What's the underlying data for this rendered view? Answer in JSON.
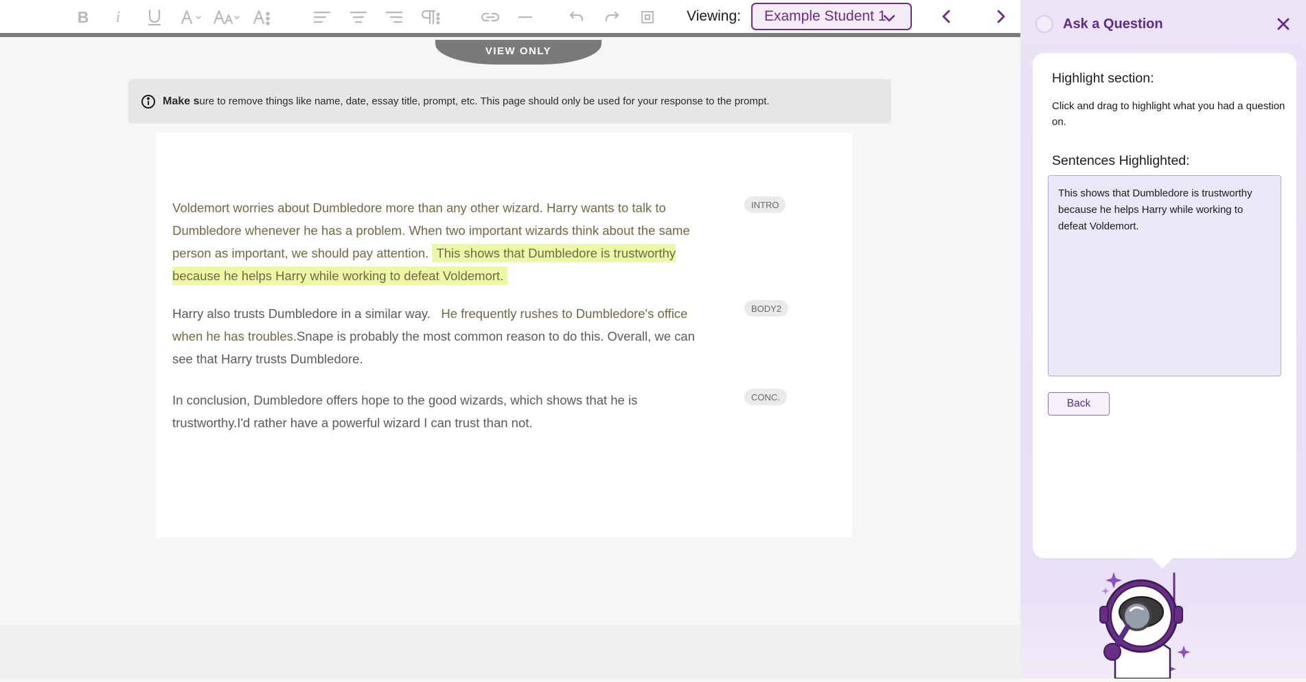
{
  "toolbar": {
    "viewing_label": "Viewing:",
    "student_selected": "Example Student 1",
    "tools": [
      "bold",
      "italic",
      "underline",
      "font-color",
      "font-size",
      "text-style",
      "align-left",
      "align-center",
      "align-right",
      "paragraph",
      "link",
      "horizontal-rule",
      "undo",
      "redo",
      "select-all"
    ]
  },
  "editor": {
    "view_only_label": "VIEW ONLY",
    "notice": {
      "bold_text": "Make s",
      "text": "ure to remove things like name, date, essay title, prompt, etc. This page should only be used for your response to the prompt."
    },
    "paragraphs": [
      {
        "tag": "INTRO",
        "lines": [
          "Voldemort worries about Dumbledore more than any other wizard.  Harry wants to talk to Dumbledore whenever he has a problem.  When two important wizards think about the same person as important, we should pay attention. "
        ],
        "highlighted": "This shows that Dumbledore is trustworthy because he helps Harry while working to defeat Voldemort."
      },
      {
        "tag": "BODY2",
        "text_a": "Harry also trusts Dumbledore in a similar way.",
        "text_b": "He frequently rushes to Dumbledore's office when he has troubles.",
        "text_c": "Snape is probably the most common reason to do this. Overall, we can see that Harry trusts Dumbledore."
      },
      {
        "tag": "CONC.",
        "text_a": "In conclusion, Dumbledore offers hope to the good wizards, which shows that he is trustworthy.",
        "text_b": "I'd rather have a powerful wizard I can trust than not."
      }
    ]
  },
  "side_panel": {
    "title": "Ask a Question",
    "highlight_heading": "Highlight section:",
    "highlight_desc": "Click and drag to highlight what you had a question on.",
    "sentences_heading": "Sentences Highlighted:",
    "sentences_value": "This shows that Dumbledore is trustworthy because he helps Harry while working to defeat Voldemort.",
    "back_label": "Back"
  },
  "colors": {
    "accent_purple": "#6a2c86",
    "highlight_yellow": "#eef7a6",
    "panel_bg": "#ece3f7"
  }
}
